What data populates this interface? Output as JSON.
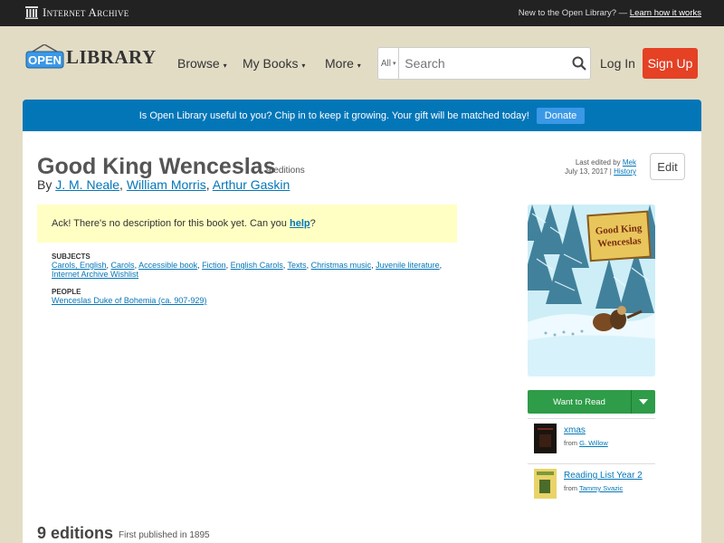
{
  "ia_bar": {
    "brand": "Internet Archive",
    "new_text": "New to the Open Library? —",
    "learn_link": "Learn how it works"
  },
  "header": {
    "logo_open": "OPEN",
    "logo_library": "LIBRARY",
    "nav": [
      "Browse",
      "My Books",
      "More"
    ],
    "search_scope": "All",
    "search_placeholder": "Search",
    "login": "Log In",
    "signup": "Sign Up"
  },
  "banner": {
    "text": "Is Open Library useful to you? Chip in to keep it growing. Your gift will be matched today!",
    "donate": "Donate"
  },
  "book": {
    "title": "Good King Wenceslas",
    "editions_count": "9 editions",
    "by": "By",
    "authors": [
      "J. M. Neale",
      "William Morris",
      "Arthur Gaskin"
    ],
    "last_edited_label": "Last edited by",
    "last_edited_by": "Mek",
    "last_edited_date": "July 13, 2017",
    "history": "History",
    "edit": "Edit",
    "nodesc_text": "Ack! There's no description for this book yet. Can you",
    "nodesc_link": "help",
    "subjects_label": "SUBJECTS",
    "subjects": [
      "Carols, English",
      "Carols",
      "Accessible book",
      "Fiction",
      "English Carols",
      "Texts",
      "Christmas music",
      "Juvenile literature",
      "Internet Archive Wishlist"
    ],
    "people_label": "PEOPLE",
    "people": [
      "Wenceslas Duke of Bohemia (ca. 907-929)"
    ],
    "cover_title_1": "Good King",
    "cover_title_2": "Wenceslas"
  },
  "sidebar": {
    "want_to_read": "Want to Read",
    "lists": [
      {
        "name": "xmas",
        "from_label": "from",
        "owner": "G. Willow"
      },
      {
        "name": "Reading List Year 2",
        "from_label": "from",
        "owner": "Tammy Svazic"
      }
    ]
  },
  "editions": {
    "heading": "9 editions",
    "first_published": "First published in 1895"
  },
  "colors": {
    "top_bar": "#222222",
    "page_bg": "#e2dcc5",
    "banner_blue": "#0376b8",
    "signup_red": "#e44125",
    "want_green": "#2e9c48",
    "nodesc_yellow": "#ffffc4"
  }
}
